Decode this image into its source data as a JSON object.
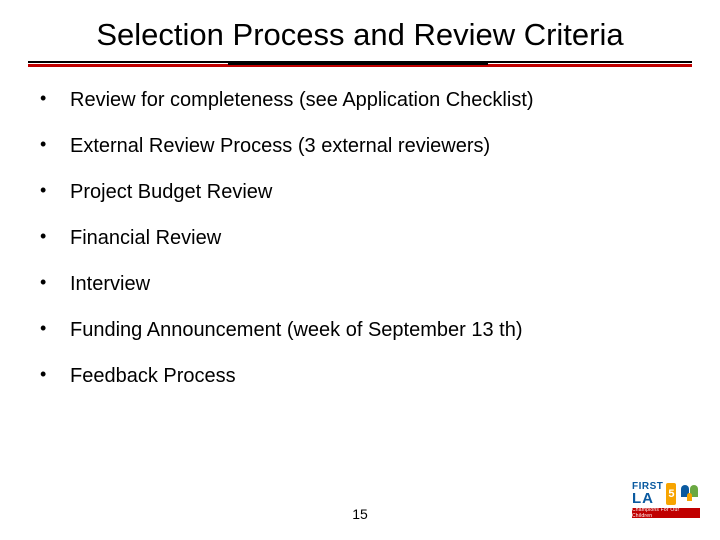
{
  "title": "Selection Process and Review Criteria",
  "bullets": {
    "b0": "Review for completeness (see Application Checklist)",
    "b1": "External Review Process (3 external reviewers)",
    "b2": "Project Budget Review",
    "b3": "Financial Review",
    "b4": "Interview",
    "b5": "Funding Announcement (week of September 13 th)",
    "b6": "Feedback Process"
  },
  "page_number": "15",
  "logo": {
    "first": "FIRST",
    "five": "5",
    "la": "LA",
    "tagline": "Champions For Our Children"
  }
}
